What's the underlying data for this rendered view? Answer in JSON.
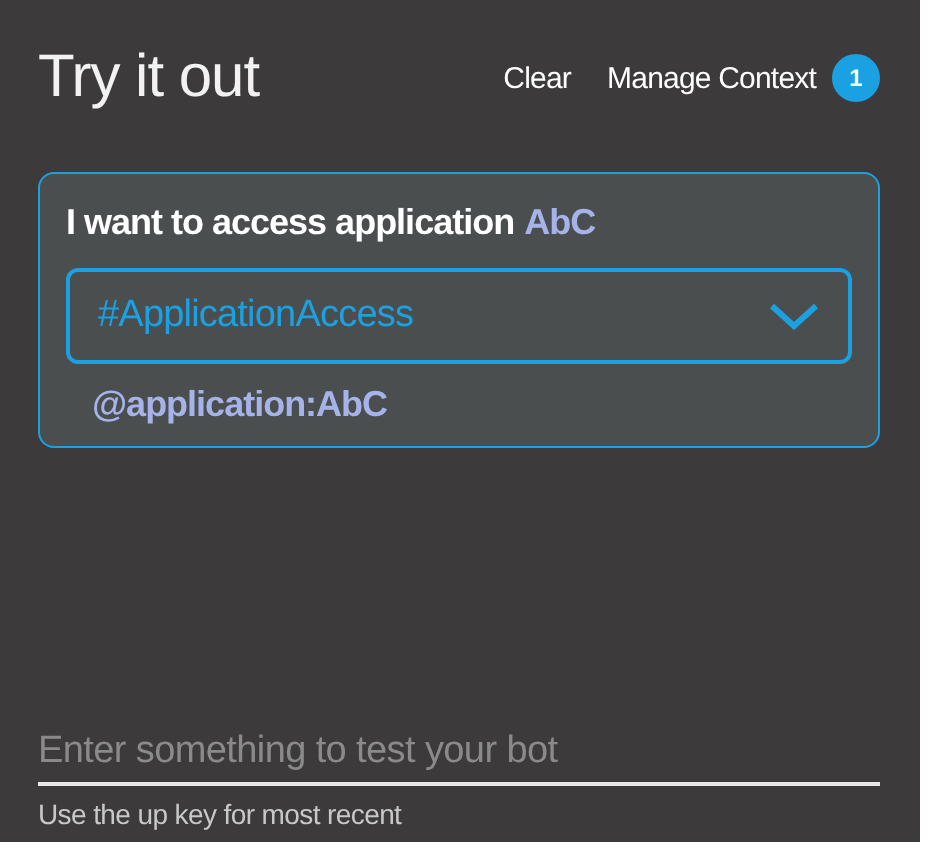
{
  "header": {
    "title": "Try it out",
    "actions": [
      {
        "label": "Clear"
      },
      {
        "label": "Manage Context"
      }
    ],
    "context_count": "1"
  },
  "message": {
    "text": "I want to access application",
    "entity_value": "AbC",
    "intent": {
      "value": "#ApplicationAccess",
      "expanded": false
    },
    "entities": [
      {
        "label": "@application:AbC"
      }
    ]
  },
  "input": {
    "placeholder": "Enter something to test your bot",
    "hint": "Use the up key for most recent"
  }
}
